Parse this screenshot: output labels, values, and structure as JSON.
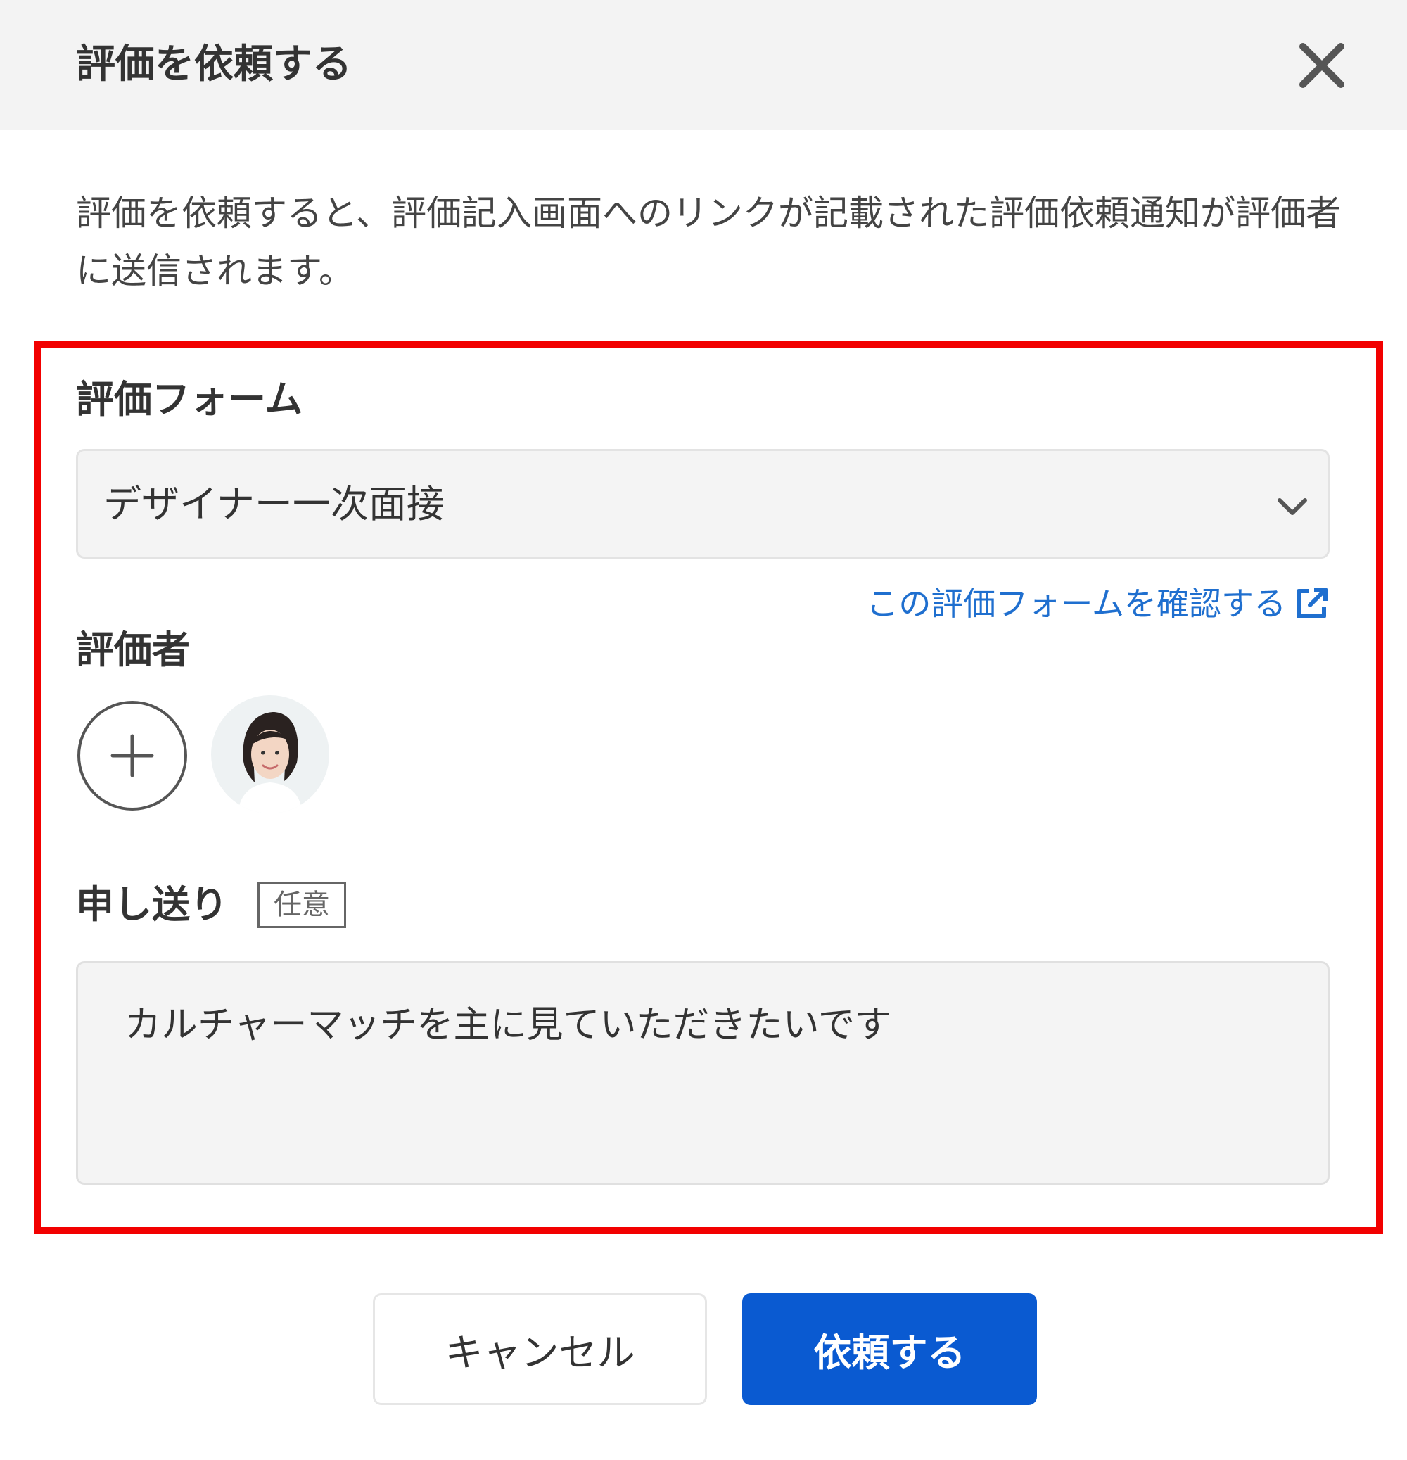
{
  "dialog": {
    "title": "評価を依頼する",
    "close_icon": "close-icon",
    "description": "評価を依頼すると、評価記入画面へのリンクが記載された評価依頼通知が評価者に送信されます。"
  },
  "evaluation_form": {
    "label": "評価フォーム",
    "selected": "デザイナー一次面接",
    "check_link": "この評価フォームを確認する",
    "link_icon": "external-link-icon"
  },
  "evaluators": {
    "label": "評価者",
    "add_icon": "plus-icon"
  },
  "notes": {
    "label": "申し送り",
    "optional_badge": "任意",
    "value": "カルチャーマッチを主に見ていただきたいです"
  },
  "actions": {
    "cancel": "キャンセル",
    "submit": "依頼する"
  },
  "colors": {
    "highlight": "#f20000",
    "primary_button": "#0a5ad1",
    "link": "#1f6fcf",
    "header_bg": "#f3f3f3"
  }
}
